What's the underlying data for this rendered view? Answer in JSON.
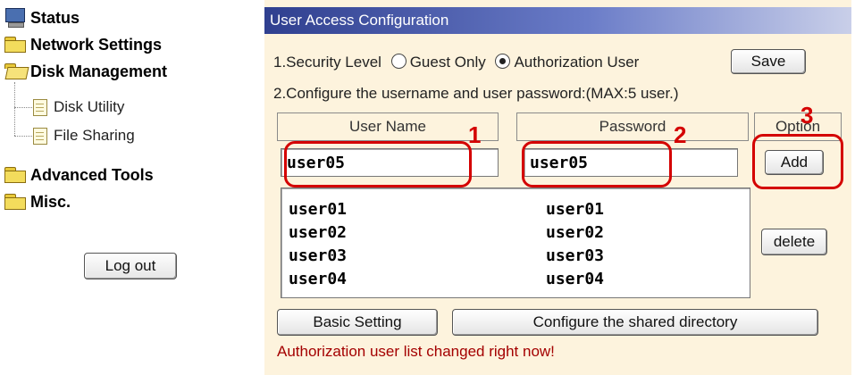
{
  "sidebar": {
    "items": [
      {
        "label": "Status",
        "icon": "monitor-icon"
      },
      {
        "label": "Network Settings",
        "icon": "folder-icon"
      },
      {
        "label": "Disk Management",
        "icon": "folder-open-icon"
      },
      {
        "label": "Advanced Tools",
        "icon": "folder-icon"
      },
      {
        "label": "Misc.",
        "icon": "folder-icon"
      }
    ],
    "subitems": [
      {
        "label": "Disk Utility",
        "icon": "document-icon"
      },
      {
        "label": "File Sharing",
        "icon": "document-icon"
      }
    ],
    "logout_label": "Log out"
  },
  "main": {
    "title": "User Access Configuration",
    "security_level_label": "1.Security Level",
    "option_guest": "Guest Only",
    "option_auth": "Authorization User",
    "selected_option": "Authorization User",
    "save_label": "Save",
    "configure_text": "2.Configure the username and user password:(MAX:5 user.)",
    "columns": [
      "User Name",
      "Password",
      "Option"
    ],
    "username_value": "user05",
    "password_value": "user05",
    "add_label": "Add",
    "delete_label": "delete",
    "users": [
      {
        "username": "user01",
        "password": "user01"
      },
      {
        "username": "user02",
        "password": "user02"
      },
      {
        "username": "user03",
        "password": "user03"
      },
      {
        "username": "user04",
        "password": "user04"
      }
    ],
    "basic_setting_label": "Basic Setting",
    "shared_dir_label": "Configure the shared directory",
    "status_message": "Authorization user list changed right now!"
  },
  "annotations": {
    "marker1": "1",
    "marker2": "2",
    "marker3": "3",
    "color": "#d40000"
  },
  "colors": {
    "title_bar": "#2f3f8f",
    "panel_bg": "#fdf3dd",
    "status_text": "#a40000"
  }
}
